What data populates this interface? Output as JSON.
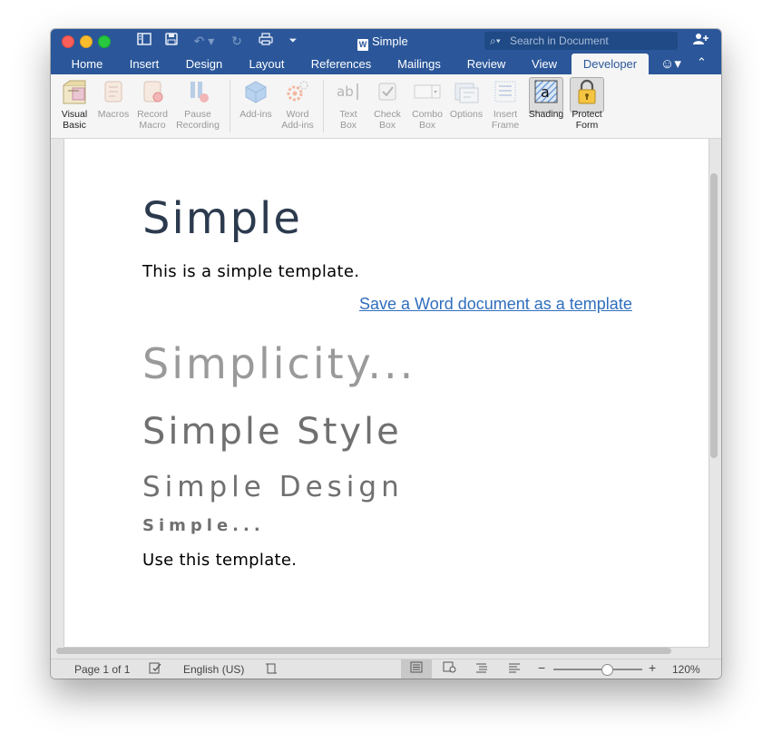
{
  "window": {
    "title": "Simple"
  },
  "search": {
    "placeholder": "Search in Document"
  },
  "tabs": [
    {
      "label": "Home"
    },
    {
      "label": "Insert"
    },
    {
      "label": "Design"
    },
    {
      "label": "Layout"
    },
    {
      "label": "References"
    },
    {
      "label": "Mailings"
    },
    {
      "label": "Review"
    },
    {
      "label": "View"
    },
    {
      "label": "Developer",
      "active": true
    }
  ],
  "ribbon": {
    "visual_basic": "Visual\nBasic",
    "macros": "Macros",
    "record_macro": "Record\nMacro",
    "pause_recording": "Pause\nRecording",
    "add_ins": "Add-ins",
    "word_add_ins": "Word\nAdd-ins",
    "text_box": "Text\nBox",
    "check_box": "Check\nBox",
    "combo_box": "Combo\nBox",
    "options": "Options",
    "insert_frame": "Insert\nFrame",
    "shading": "Shading",
    "protect_form": "Protect\nForm"
  },
  "document": {
    "title": "Simple",
    "body1": "This is a simple template.",
    "link": "Save a Word document as a template",
    "heading1": "Simplicity...",
    "heading2": "Simple Style",
    "heading3": "Simple Design",
    "heading4": "Simple...",
    "body2": "Use this template."
  },
  "status": {
    "page": "Page 1 of 1",
    "language": "English (US)",
    "zoom": "120%",
    "zoom_level": 0.6
  },
  "colors": {
    "ribbon_blue": "#2b579a",
    "link": "#2f6ebd",
    "title_text": "#2c3a4e"
  }
}
